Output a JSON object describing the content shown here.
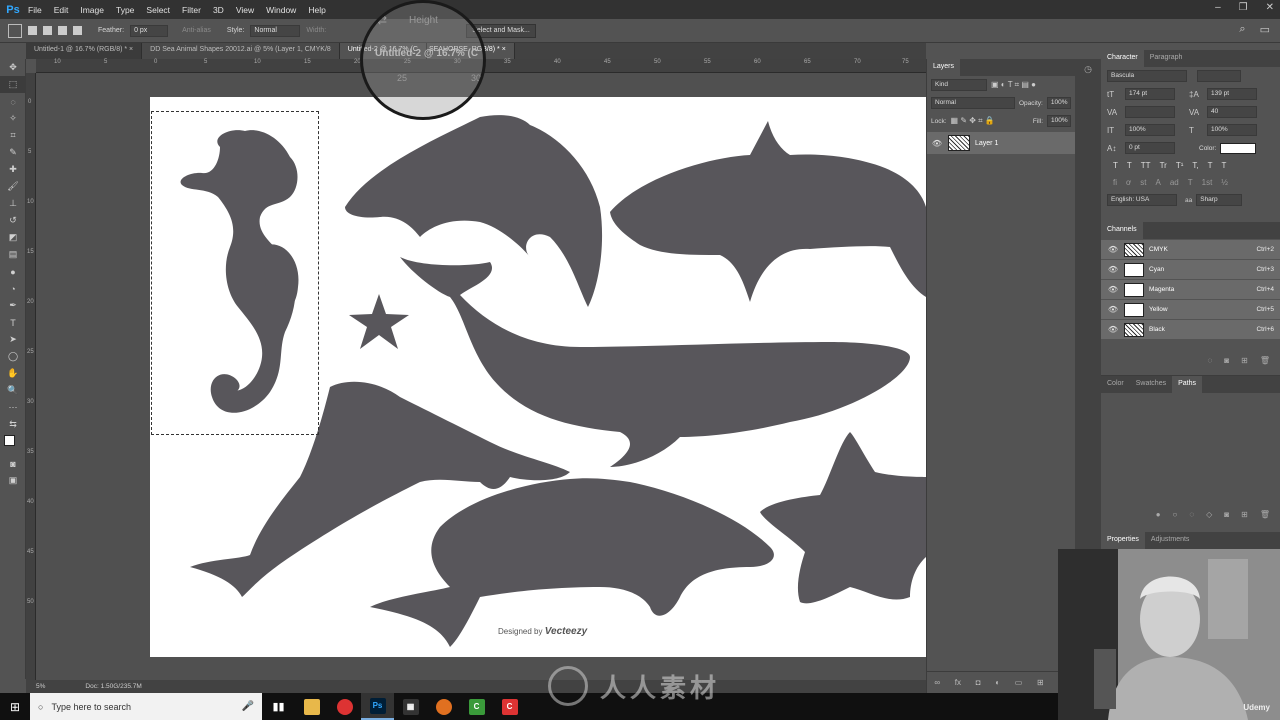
{
  "app": {
    "logo": "Ps",
    "accent": "#31a8ff"
  },
  "menu": [
    "File",
    "Edit",
    "Image",
    "Type",
    "Select",
    "Filter",
    "3D",
    "View",
    "Window",
    "Help"
  ],
  "options": {
    "feather_label": "Feather:",
    "feather_value": "0 px",
    "anti_alias": "Anti-alias",
    "style_label": "Style:",
    "style_value": "Normal",
    "width_label": "Width:",
    "select_mask": "Select and Mask..."
  },
  "tabs": [
    {
      "label": "Untitled-1 @ 16.7% (RGB/8) *",
      "close": "×"
    },
    {
      "label": "DD Sea Animal Shapes 20012.ai @ 5% (Layer 1, CMYK/8",
      "close": ""
    },
    {
      "label": "Untitled-2 @ 16.7% (C",
      "close": ""
    },
    {
      "label": "SEAHORSE, RGB/8) *",
      "close": "×"
    }
  ],
  "ruler": {
    "top": [
      "10",
      "5",
      "0",
      "5",
      "10",
      "15",
      "20",
      "25",
      "30",
      "35",
      "40",
      "45",
      "50",
      "55",
      "60",
      "65",
      "70",
      "75"
    ],
    "left": [
      "0",
      "5",
      "10",
      "15",
      "20",
      "25",
      "30",
      "35",
      "40",
      "45",
      "50"
    ]
  },
  "magnifier": {
    "label": "Height",
    "title": "Untitled-2 @ 16.7% (C",
    "n1": "25",
    "n2": "30"
  },
  "canvas": {
    "credit_prefix": "Designed by",
    "credit_brand": "Vecteezy",
    "shape_color": "#58565b"
  },
  "status": {
    "zoom": "5%",
    "doc": "Doc: 1.50G/235.7M"
  },
  "layers": {
    "tabs": [
      "Layers"
    ],
    "kind": "Kind",
    "blend": "Normal",
    "opacity_label": "Opacity:",
    "opacity": "100%",
    "lock_label": "Lock:",
    "fill_label": "Fill:",
    "fill": "100%",
    "rows": [
      {
        "name": "Layer 1"
      }
    ],
    "footer": [
      "∞",
      "fx",
      "◘",
      "◐",
      "▭",
      "⊞",
      "🗑"
    ]
  },
  "character": {
    "tabs": [
      "Character",
      "Paragraph"
    ],
    "font": "Bascula",
    "size": "174 pt",
    "leading": "139 pt",
    "tracking": "40",
    "vscale": "100%",
    "hscale": "100%",
    "baseline": "0 pt",
    "color_label": "Color:",
    "styles": [
      "T",
      "T",
      "TT",
      "Tr",
      "T¹",
      "T,",
      "T",
      "T"
    ],
    "extras": [
      "fi",
      "ơ",
      "st",
      "A",
      "ad",
      "T",
      "1st",
      "½"
    ],
    "language": "English: USA",
    "aa": "Sharp",
    "aa_icon": "aa"
  },
  "channels": {
    "title": "Channels",
    "rows": [
      {
        "name": "CMYK",
        "shortcut": "Ctrl+2"
      },
      {
        "name": "Cyan",
        "shortcut": "Ctrl+3"
      },
      {
        "name": "Magenta",
        "shortcut": "Ctrl+4"
      },
      {
        "name": "Yellow",
        "shortcut": "Ctrl+5"
      },
      {
        "name": "Black",
        "shortcut": "Ctrl+6"
      }
    ]
  },
  "color_tabs": [
    "Color",
    "Swatches",
    "Paths"
  ],
  "properties_tabs": [
    "Properties",
    "Adjustments"
  ],
  "webcam": {
    "badge": "Udemy"
  },
  "taskbar": {
    "search_placeholder": "Type here to search"
  },
  "watermark": "人人素材"
}
